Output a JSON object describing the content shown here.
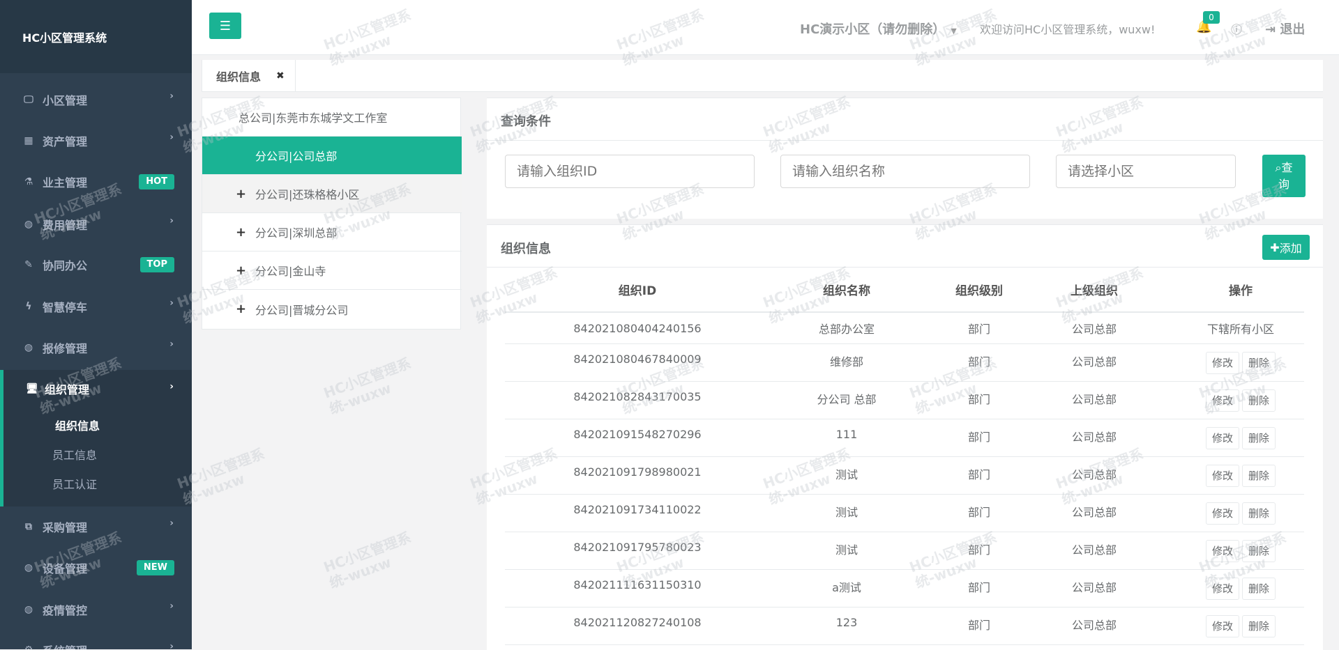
{
  "app": {
    "title": "HC小区管理系统"
  },
  "sidebar": {
    "items": [
      {
        "label": "小区管理",
        "icon": "laptop-icon",
        "badge": ""
      },
      {
        "label": "资产管理",
        "icon": "grid-icon",
        "badge": ""
      },
      {
        "label": "业主管理",
        "icon": "flask-icon",
        "badge": "HOT"
      },
      {
        "label": "费用管理",
        "icon": "globe-icon",
        "badge": ""
      },
      {
        "label": "协同办公",
        "icon": "edit-icon",
        "badge": "TOP"
      },
      {
        "label": "智慧停车",
        "icon": "bolt-icon",
        "badge": ""
      },
      {
        "label": "报修管理",
        "icon": "globe-icon",
        "badge": ""
      },
      {
        "label": "组织管理",
        "icon": "desktop-icon",
        "badge": ""
      },
      {
        "label": "采购管理",
        "icon": "copy-icon",
        "badge": ""
      },
      {
        "label": "设备管理",
        "icon": "globe-icon",
        "badge": "NEW"
      },
      {
        "label": "疫情管控",
        "icon": "globe-icon",
        "badge": ""
      },
      {
        "label": "系统管理",
        "icon": "gear-icon",
        "badge": ""
      }
    ],
    "active_submenu": [
      "组织信息",
      "员工信息",
      "员工认证"
    ]
  },
  "topbar": {
    "community": "HC演示小区（请勿删除）",
    "welcome": "欢迎访问HC小区管理系统，wuxw!",
    "notification_count": "0",
    "logout": "退出"
  },
  "tabs": [
    {
      "label": "组织信息"
    }
  ],
  "tree": [
    {
      "label": "总公司|东莞市东城学文工作室",
      "expandable": false
    },
    {
      "label": "分公司|公司总部",
      "expandable": false
    },
    {
      "label": "分公司|还珠格格小区",
      "expandable": true
    },
    {
      "label": "分公司|深圳总部",
      "expandable": true
    },
    {
      "label": "分公司|金山寺",
      "expandable": true
    },
    {
      "label": "分公司|晋城分公司",
      "expandable": true
    }
  ],
  "query": {
    "title": "查询条件",
    "org_id_placeholder": "请输入组织ID",
    "org_name_placeholder": "请输入组织名称",
    "community_placeholder": "请选择小区",
    "search_label_1": "查",
    "search_label_2": "询"
  },
  "info": {
    "title": "组织信息",
    "add_label": "添加",
    "columns": [
      "组织ID",
      "组织名称",
      "组织级别",
      "上级组织",
      "操作"
    ],
    "edit_label": "修改",
    "delete_label": "删除",
    "first_row_action": "下辖所有小区",
    "rows": [
      {
        "id": "842021080404240156",
        "name": "总部办公室",
        "level": "部门",
        "parent": "公司总部"
      },
      {
        "id": "842021080467840009",
        "name": "维修部",
        "level": "部门",
        "parent": "公司总部"
      },
      {
        "id": "842021082843170035",
        "name": "分公司 总部",
        "level": "部门",
        "parent": "公司总部"
      },
      {
        "id": "842021091548270296",
        "name": "111",
        "level": "部门",
        "parent": "公司总部"
      },
      {
        "id": "842021091798980021",
        "name": "测试",
        "level": "部门",
        "parent": "公司总部"
      },
      {
        "id": "842021091734110022",
        "name": "测试",
        "level": "部门",
        "parent": "公司总部"
      },
      {
        "id": "842021091795780023",
        "name": "测试",
        "level": "部门",
        "parent": "公司总部"
      },
      {
        "id": "842021111631150310",
        "name": "a测试",
        "level": "部门",
        "parent": "公司总部"
      },
      {
        "id": "842021120827240108",
        "name": "123",
        "level": "部门",
        "parent": "公司总部"
      }
    ]
  },
  "watermark": {
    "line1": "HC小区管理系",
    "line2": "统-wuxw"
  },
  "colors": {
    "accent": "#1ab394",
    "sidebar": "#2f4050"
  }
}
